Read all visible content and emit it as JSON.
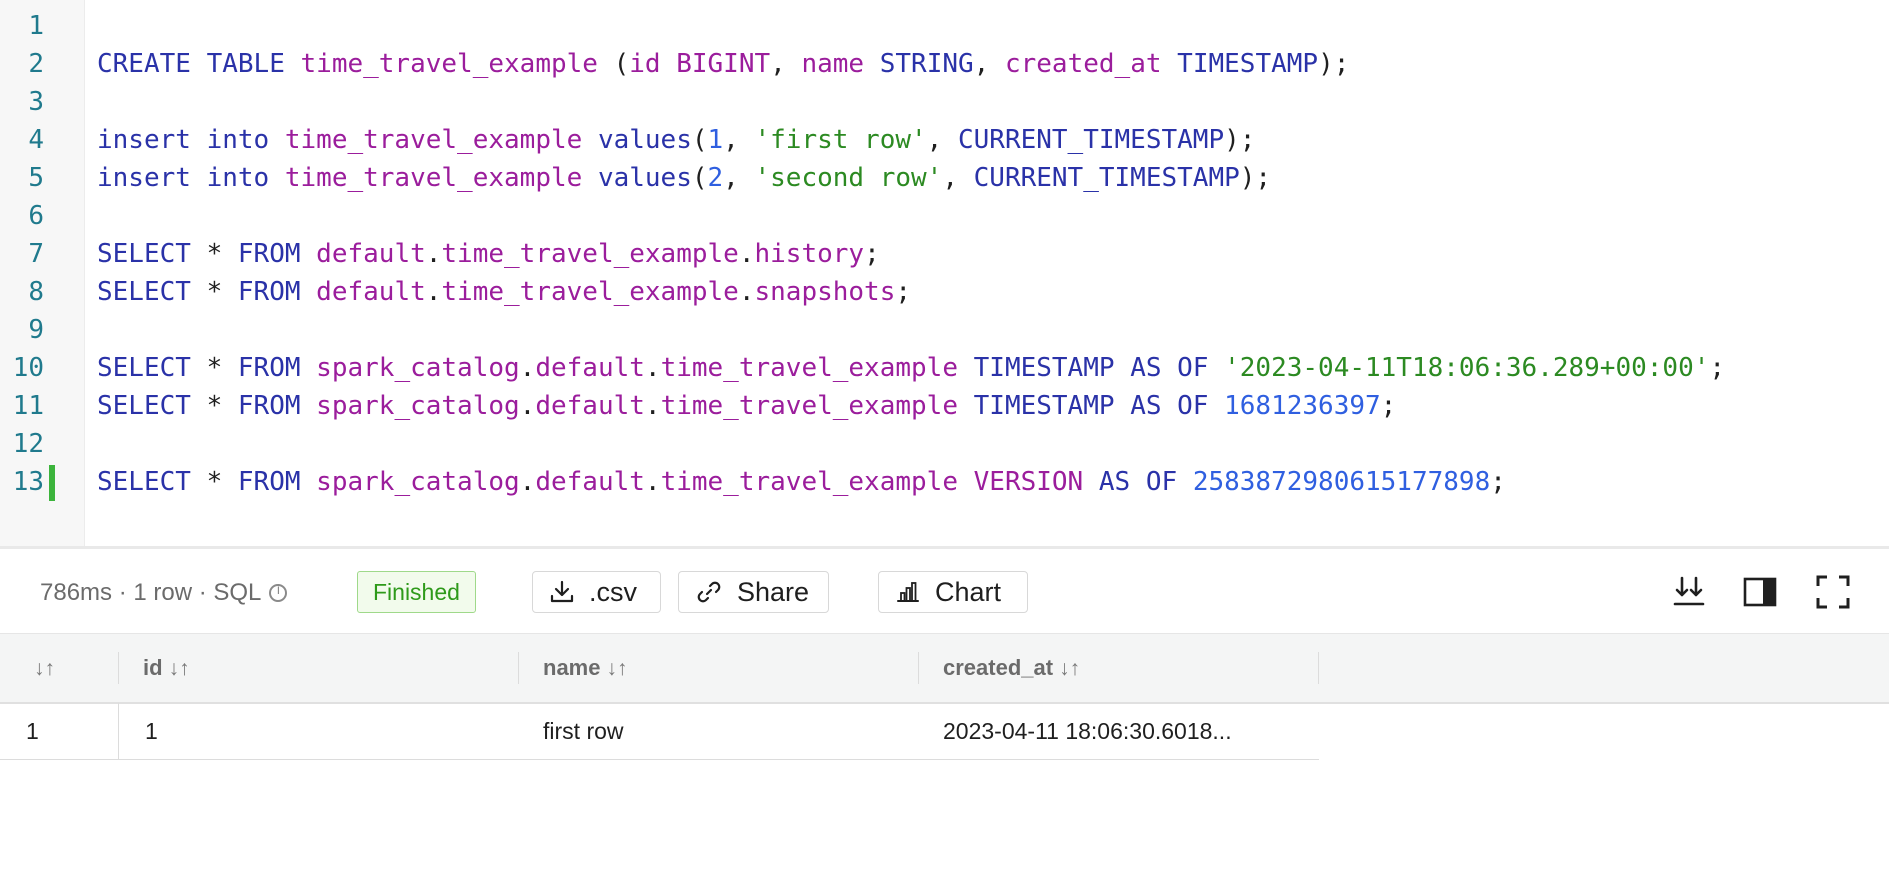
{
  "editor": {
    "lines": [
      {
        "n": "1",
        "tokens": []
      },
      {
        "n": "2",
        "tokens": [
          {
            "t": "CREATE",
            "c": "kw"
          },
          {
            "t": " ",
            "c": "pn"
          },
          {
            "t": "TABLE",
            "c": "kw"
          },
          {
            "t": " ",
            "c": "pn"
          },
          {
            "t": "time_travel_example",
            "c": "id"
          },
          {
            "t": " (",
            "c": "pn"
          },
          {
            "t": "id",
            "c": "id"
          },
          {
            "t": " ",
            "c": "pn"
          },
          {
            "t": "BIGINT",
            "c": "id"
          },
          {
            "t": ", ",
            "c": "pn"
          },
          {
            "t": "name",
            "c": "id"
          },
          {
            "t": " ",
            "c": "pn"
          },
          {
            "t": "STRING",
            "c": "kw"
          },
          {
            "t": ", ",
            "c": "pn"
          },
          {
            "t": "created_at",
            "c": "id"
          },
          {
            "t": " ",
            "c": "pn"
          },
          {
            "t": "TIMESTAMP",
            "c": "kw"
          },
          {
            "t": ");",
            "c": "pn"
          }
        ]
      },
      {
        "n": "3",
        "tokens": []
      },
      {
        "n": "4",
        "tokens": [
          {
            "t": "insert",
            "c": "kw"
          },
          {
            "t": " ",
            "c": "pn"
          },
          {
            "t": "into",
            "c": "kw"
          },
          {
            "t": " ",
            "c": "pn"
          },
          {
            "t": "time_travel_example",
            "c": "id"
          },
          {
            "t": " ",
            "c": "pn"
          },
          {
            "t": "values",
            "c": "kw"
          },
          {
            "t": "(",
            "c": "pn"
          },
          {
            "t": "1",
            "c": "num"
          },
          {
            "t": ", ",
            "c": "pn"
          },
          {
            "t": "'first row'",
            "c": "str"
          },
          {
            "t": ", ",
            "c": "pn"
          },
          {
            "t": "CURRENT_TIMESTAMP",
            "c": "kw"
          },
          {
            "t": ");",
            "c": "pn"
          }
        ]
      },
      {
        "n": "5",
        "tokens": [
          {
            "t": "insert",
            "c": "kw"
          },
          {
            "t": " ",
            "c": "pn"
          },
          {
            "t": "into",
            "c": "kw"
          },
          {
            "t": " ",
            "c": "pn"
          },
          {
            "t": "time_travel_example",
            "c": "id"
          },
          {
            "t": " ",
            "c": "pn"
          },
          {
            "t": "values",
            "c": "kw"
          },
          {
            "t": "(",
            "c": "pn"
          },
          {
            "t": "2",
            "c": "num"
          },
          {
            "t": ", ",
            "c": "pn"
          },
          {
            "t": "'second row'",
            "c": "str"
          },
          {
            "t": ", ",
            "c": "pn"
          },
          {
            "t": "CURRENT_TIMESTAMP",
            "c": "kw"
          },
          {
            "t": ");",
            "c": "pn"
          }
        ]
      },
      {
        "n": "6",
        "tokens": []
      },
      {
        "n": "7",
        "tokens": [
          {
            "t": "SELECT",
            "c": "kw"
          },
          {
            "t": " * ",
            "c": "pn"
          },
          {
            "t": "FROM",
            "c": "kw"
          },
          {
            "t": " ",
            "c": "pn"
          },
          {
            "t": "default",
            "c": "id"
          },
          {
            "t": ".",
            "c": "pn"
          },
          {
            "t": "time_travel_example",
            "c": "id"
          },
          {
            "t": ".",
            "c": "pn"
          },
          {
            "t": "history",
            "c": "id"
          },
          {
            "t": ";",
            "c": "pn"
          }
        ]
      },
      {
        "n": "8",
        "tokens": [
          {
            "t": "SELECT",
            "c": "kw"
          },
          {
            "t": " * ",
            "c": "pn"
          },
          {
            "t": "FROM",
            "c": "kw"
          },
          {
            "t": " ",
            "c": "pn"
          },
          {
            "t": "default",
            "c": "id"
          },
          {
            "t": ".",
            "c": "pn"
          },
          {
            "t": "time_travel_example",
            "c": "id"
          },
          {
            "t": ".",
            "c": "pn"
          },
          {
            "t": "snapshots",
            "c": "id"
          },
          {
            "t": ";",
            "c": "pn"
          }
        ]
      },
      {
        "n": "9",
        "tokens": []
      },
      {
        "n": "10",
        "tokens": [
          {
            "t": "SELECT",
            "c": "kw"
          },
          {
            "t": " * ",
            "c": "pn"
          },
          {
            "t": "FROM",
            "c": "kw"
          },
          {
            "t": " ",
            "c": "pn"
          },
          {
            "t": "spark_catalog",
            "c": "id"
          },
          {
            "t": ".",
            "c": "pn"
          },
          {
            "t": "default",
            "c": "id"
          },
          {
            "t": ".",
            "c": "pn"
          },
          {
            "t": "time_travel_example",
            "c": "id"
          },
          {
            "t": " ",
            "c": "pn"
          },
          {
            "t": "TIMESTAMP",
            "c": "kw"
          },
          {
            "t": " ",
            "c": "pn"
          },
          {
            "t": "AS",
            "c": "kw"
          },
          {
            "t": " ",
            "c": "pn"
          },
          {
            "t": "OF",
            "c": "kw"
          },
          {
            "t": " ",
            "c": "pn"
          },
          {
            "t": "'2023-04-11T18:06:36.289+00:00'",
            "c": "str"
          },
          {
            "t": ";",
            "c": "pn"
          }
        ]
      },
      {
        "n": "11",
        "tokens": [
          {
            "t": "SELECT",
            "c": "kw"
          },
          {
            "t": " * ",
            "c": "pn"
          },
          {
            "t": "FROM",
            "c": "kw"
          },
          {
            "t": " ",
            "c": "pn"
          },
          {
            "t": "spark_catalog",
            "c": "id"
          },
          {
            "t": ".",
            "c": "pn"
          },
          {
            "t": "default",
            "c": "id"
          },
          {
            "t": ".",
            "c": "pn"
          },
          {
            "t": "time_travel_example",
            "c": "id"
          },
          {
            "t": " ",
            "c": "pn"
          },
          {
            "t": "TIMESTAMP",
            "c": "kw"
          },
          {
            "t": " ",
            "c": "pn"
          },
          {
            "t": "AS",
            "c": "kw"
          },
          {
            "t": " ",
            "c": "pn"
          },
          {
            "t": "OF",
            "c": "kw"
          },
          {
            "t": " ",
            "c": "pn"
          },
          {
            "t": "1681236397",
            "c": "num"
          },
          {
            "t": ";",
            "c": "pn"
          }
        ]
      },
      {
        "n": "12",
        "tokens": []
      },
      {
        "n": "13",
        "tokens": [
          {
            "t": "SELECT",
            "c": "kw"
          },
          {
            "t": " * ",
            "c": "pn"
          },
          {
            "t": "FROM",
            "c": "kw"
          },
          {
            "t": " ",
            "c": "pn"
          },
          {
            "t": "spark_catalog",
            "c": "id"
          },
          {
            "t": ".",
            "c": "pn"
          },
          {
            "t": "default",
            "c": "id"
          },
          {
            "t": ".",
            "c": "pn"
          },
          {
            "t": "time_travel_example",
            "c": "id"
          },
          {
            "t": " ",
            "c": "pn"
          },
          {
            "t": "VERSION",
            "c": "id"
          },
          {
            "t": " ",
            "c": "pn"
          },
          {
            "t": "AS",
            "c": "kw"
          },
          {
            "t": " ",
            "c": "pn"
          },
          {
            "t": "OF",
            "c": "kw"
          },
          {
            "t": " ",
            "c": "pn"
          },
          {
            "t": "2583872980615177898",
            "c": "num"
          },
          {
            "t": ";",
            "c": "pn"
          }
        ]
      }
    ],
    "active_line": "13"
  },
  "results": {
    "meta_text": "786ms · 1 row · SQL",
    "status": "Finished",
    "csv_label": ".csv",
    "share_label": "Share",
    "chart_label": "Chart"
  },
  "grid": {
    "columns": [
      {
        "label": "",
        "sort": "↓↑"
      },
      {
        "label": "id",
        "sort": "↓↑"
      },
      {
        "label": "name",
        "sort": "↓↑"
      },
      {
        "label": "created_at",
        "sort": "↓↑"
      }
    ],
    "rows": [
      {
        "index": "1",
        "id": "1",
        "name": "first row",
        "created_at": "2023-04-11 18:06:30.6018..."
      }
    ]
  },
  "colors": {
    "keyword": "#2a32a8",
    "identifier": "#9b1d9c",
    "string": "#2c8a22",
    "number": "#2f5fe0",
    "line_number": "#207a8d",
    "finished_badge": "#2e9a1a"
  }
}
